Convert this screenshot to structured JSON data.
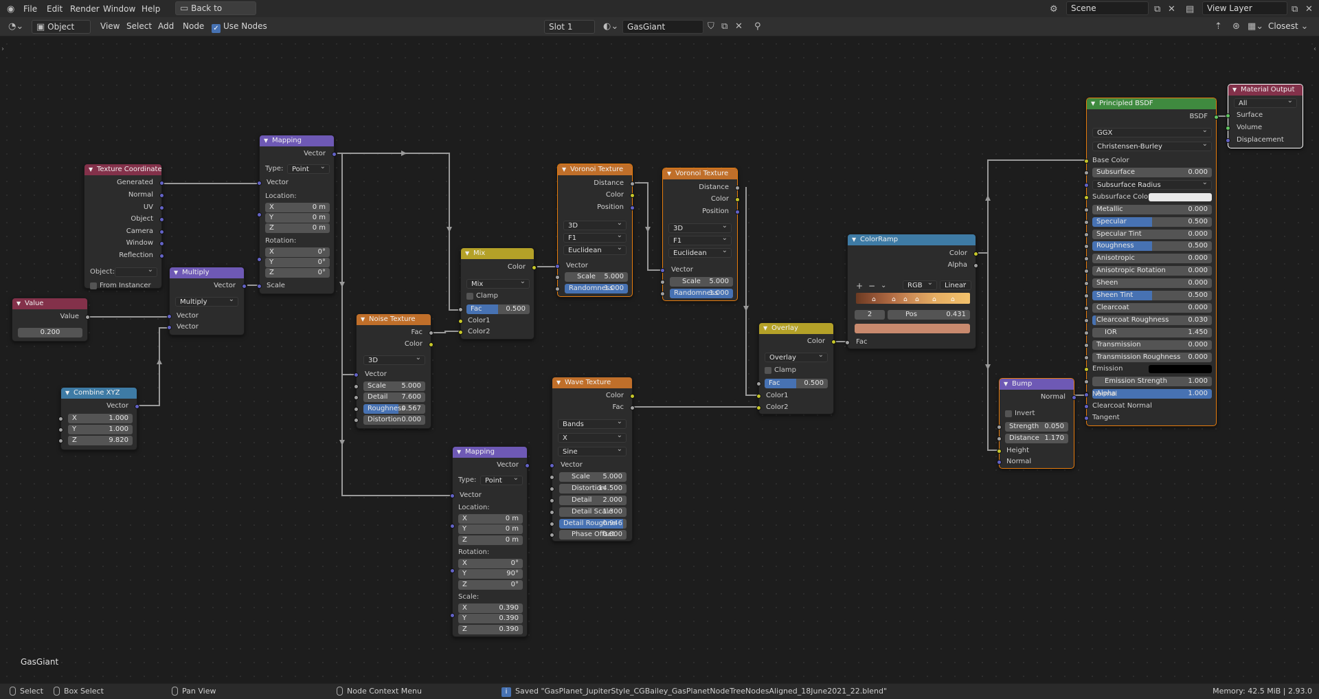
{
  "menu": {
    "file": "File",
    "edit": "Edit",
    "render": "Render",
    "window": "Window",
    "help": "Help",
    "back_to_previous": "Back to Previous",
    "scene_name": "Scene",
    "view_layer_name": "View Layer"
  },
  "header": {
    "mode": "Object",
    "view": "View",
    "select": "Select",
    "add": "Add",
    "node": "Node",
    "use_nodes": "Use Nodes",
    "slot": "Slot 1",
    "material": "GasGiant",
    "shading": "Closest"
  },
  "editor": {
    "material_label": "GasGiant"
  },
  "nodes": {
    "texcoord": {
      "title": "Texture Coordinate",
      "outputs": [
        "Generated",
        "Normal",
        "UV",
        "Object",
        "Camera",
        "Window",
        "Reflection"
      ],
      "object_label": "Object:",
      "from_instancer": "From Instancer"
    },
    "value": {
      "title": "Value",
      "output": "Value",
      "val": "0.200"
    },
    "combine": {
      "title": "Combine XYZ",
      "output": "Vector",
      "x_l": "X",
      "x": "1.000",
      "y_l": "Y",
      "y": "1.000",
      "z_l": "Z",
      "z": "9.820"
    },
    "multiply": {
      "title": "Multiply",
      "output": "Vector",
      "op": "Multiply",
      "in1": "Vector",
      "in2": "Vector"
    },
    "mapping1": {
      "title": "Mapping",
      "output": "Vector",
      "type_label": "Type:",
      "type": "Point",
      "in_vector": "Vector",
      "loc_label": "Location:",
      "lx": "0 m",
      "ly": "0 m",
      "lz": "0 m",
      "rot_label": "Rotation:",
      "rx": "0°",
      "ry": "0°",
      "rz": "0°",
      "scale": "Scale",
      "x": "X",
      "y": "Y",
      "z": "Z"
    },
    "noise": {
      "title": "Noise Texture",
      "out_fac": "Fac",
      "out_color": "Color",
      "dim": "3D",
      "in_vector": "Vector",
      "scale_l": "Scale",
      "scale": "5.000",
      "detail_l": "Detail",
      "detail": "7.600",
      "rough_l": "Roughness",
      "rough": "0.567",
      "rough_frac": 0.567,
      "dist_l": "Distortion",
      "dist": "0.000"
    },
    "mix": {
      "title": "Mix",
      "out": "Color",
      "mode": "Mix",
      "clamp": "Clamp",
      "fac_l": "Fac",
      "fac": "0.500",
      "fac_frac": 0.5,
      "c1": "Color1",
      "c2": "Color2"
    },
    "voronoi1": {
      "title": "Voronoi Texture",
      "out1": "Distance",
      "out2": "Color",
      "out3": "Position",
      "dim": "3D",
      "feature": "F1",
      "metric": "Euclidean",
      "in_vector": "Vector",
      "scale_l": "Scale",
      "scale": "5.000",
      "rand_l": "Randomness",
      "rand": "1.000",
      "rand_frac": 1.0
    },
    "voronoi2": {
      "title": "Voronoi Texture",
      "out1": "Distance",
      "out2": "Color",
      "out3": "Position",
      "dim": "3D",
      "feature": "F1",
      "metric": "Euclidean",
      "in_vector": "Vector",
      "scale_l": "Scale",
      "scale": "5.000",
      "rand_l": "Randomness",
      "rand": "1.000",
      "rand_frac": 1.0
    },
    "wave": {
      "title": "Wave Texture",
      "out_color": "Color",
      "out_fac": "Fac",
      "type": "Bands",
      "dir": "X",
      "profile": "Sine",
      "in_vector": "Vector",
      "scale_l": "Scale",
      "scale": "5.000",
      "dist_l": "Distortion",
      "dist": "14.500",
      "detail_l": "Detail",
      "detail": "2.000",
      "dscale_l": "Detail Scale",
      "dscale": "1.300",
      "drough_l": "Detail Roughne",
      "drough": "0.946",
      "drough_frac": 0.946,
      "phase_l": "Phase Offset",
      "phase": "0.000"
    },
    "mapping2": {
      "title": "Mapping",
      "output": "Vector",
      "type_label": "Type:",
      "type": "Point",
      "in_vector": "Vector",
      "loc_label": "Location:",
      "lx": "0 m",
      "ly": "0 m",
      "lz": "0 m",
      "rot_label": "Rotation:",
      "rx": "0°",
      "ry": "90°",
      "rz": "0°",
      "scale_label": "Scale:",
      "sx": "0.390",
      "sy": "0.390",
      "sz": "0.390",
      "x": "X",
      "y": "Y",
      "z": "Z"
    },
    "overlay": {
      "title": "Overlay",
      "out": "Color",
      "mode": "Overlay",
      "clamp": "Clamp",
      "fac_l": "Fac",
      "fac": "0.500",
      "fac_frac": 0.5,
      "c1": "Color1",
      "c2": "Color2"
    },
    "colorramp": {
      "title": "ColorRamp",
      "out_color": "Color",
      "out_alpha": "Alpha",
      "plus": "+",
      "minus": "−",
      "mode": "RGB",
      "interp": "Linear",
      "index": "2",
      "pos_l": "Pos",
      "pos": "0.431",
      "in_fac": "Fac",
      "swatch": "#c98a6e"
    },
    "bump": {
      "title": "Bump",
      "out": "Normal",
      "invert": "Invert",
      "strength_l": "Strength",
      "strength": "0.050",
      "distance_l": "Distance",
      "distance": "1.170",
      "in_height": "Height",
      "in_normal": "Normal"
    },
    "bsdf": {
      "title": "Principled BSDF",
      "out": "BSDF",
      "dist": "GGX",
      "sss": "Christensen-Burley",
      "base_color": "Base Color",
      "rows": [
        {
          "l": "Subsurface",
          "v": "0.000",
          "f": 0
        },
        {
          "l": "Subsurface Radius",
          "v": "",
          "f": 0,
          "dd": true
        },
        {
          "l": "Subsurface Colo",
          "v": "",
          "f": 0,
          "swatch": "#e8e8e8"
        },
        {
          "l": "Metallic",
          "v": "0.000",
          "f": 0
        },
        {
          "l": "Specular",
          "v": "0.500",
          "f": 0.5
        },
        {
          "l": "Specular Tint",
          "v": "0.000",
          "f": 0
        },
        {
          "l": "Roughness",
          "v": "0.500",
          "f": 0.5
        },
        {
          "l": "Anisotropic",
          "v": "0.000",
          "f": 0
        },
        {
          "l": "Anisotropic Rotation",
          "v": "0.000",
          "f": 0
        },
        {
          "l": "Sheen",
          "v": "0.000",
          "f": 0
        },
        {
          "l": "Sheen Tint",
          "v": "0.500",
          "f": 0.5
        },
        {
          "l": "Clearcoat",
          "v": "0.000",
          "f": 0
        },
        {
          "l": "Clearcoat Roughness",
          "v": "0.030",
          "f": 0.03
        },
        {
          "l": "IOR",
          "v": "1.450",
          "f": 0
        },
        {
          "l": "Transmission",
          "v": "0.000",
          "f": 0
        },
        {
          "l": "Transmission Roughness",
          "v": "0.000",
          "f": 0
        },
        {
          "l": "Emission",
          "v": "",
          "f": 0,
          "swatch": "#000000"
        },
        {
          "l": "Emission Strength",
          "v": "1.000",
          "f": 0
        },
        {
          "l": "Alpha",
          "v": "1.000",
          "f": 1
        }
      ],
      "normal": "Normal",
      "cc_normal": "Clearcoat Normal",
      "tangent": "Tangent"
    },
    "output": {
      "title": "Material Output",
      "target": "All",
      "surface": "Surface",
      "volume": "Volume",
      "displacement": "Displacement"
    }
  },
  "status": {
    "select": "Select",
    "box_select": "Box Select",
    "pan_view": "Pan View",
    "context_menu": "Node Context Menu",
    "saved": "Saved \"GasPlanet_JupiterStyle_CGBailey_GasPlanetNodeTreeNodesAligned_18June2021_22.blend\"",
    "memory": "Memory: 42.5 MiB | 2.93.0"
  },
  "colors": {
    "accent": "#4772b3",
    "selected_outline": "#e87d0d"
  }
}
